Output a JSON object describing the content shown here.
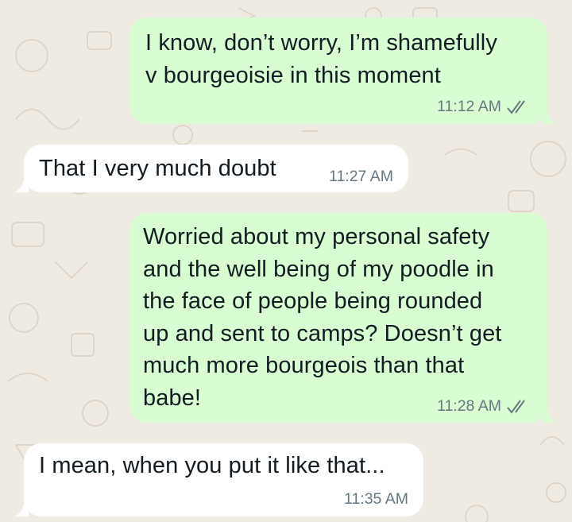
{
  "chat": {
    "messages": [
      {
        "direction": "outgoing",
        "text": "I know, don’t worry, I’m shamefully\nv bourgeoisie in this moment",
        "time": "11:12 AM",
        "status": "read",
        "status_icon": "double-check-icon"
      },
      {
        "direction": "incoming",
        "text": "That I very much doubt",
        "time": "11:27 AM"
      },
      {
        "direction": "outgoing",
        "text": "Worried about my personal safety\nand the well being of my poodle in\nthe face of people being rounded\nup and sent to camps? Doesn’t get\nmuch more bourgeois than that\nbabe!",
        "time": "11:28 AM",
        "status": "read",
        "status_icon": "double-check-icon"
      },
      {
        "direction": "incoming",
        "text": "I mean, when you put it like that...",
        "time": "11:35 AM"
      }
    ]
  },
  "colors": {
    "background": "#efeae2",
    "outgoing_bubble": "#d9fdd3",
    "incoming_bubble": "#ffffff",
    "text": "#111b21",
    "meta_text": "#667781"
  }
}
